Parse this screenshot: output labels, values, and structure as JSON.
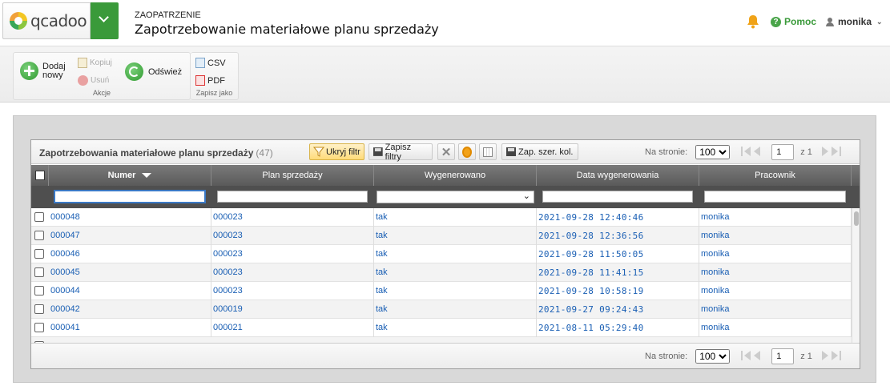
{
  "header": {
    "brand": "qcadoo",
    "breadcrumb": "ZAOPATRZENIE",
    "title": "Zapotrzebowanie materiałowe planu sprzedaży",
    "help": "Pomoc",
    "user": "monika"
  },
  "ribbon": {
    "actions": {
      "add": "Dodaj nowy",
      "add_l1": "Dodaj",
      "add_l2": "nowy",
      "copy": "Kopiuj",
      "delete": "Usuń",
      "refresh": "Odśwież",
      "group": "Akcje"
    },
    "export": {
      "csv": "CSV",
      "pdf": "PDF",
      "group": "Zapisz jako"
    }
  },
  "grid": {
    "title": "Zapotrzebowania materiałowe planu sprzedaży",
    "count": "(47)",
    "buttons": {
      "hide_filter": "Ukryj filtr",
      "save_filters": "Zapisz filtry",
      "save_widths": "Zap. szer. kol."
    },
    "paging": {
      "per_page_label": "Na stronie:",
      "per_page": "100",
      "page": "1",
      "of": "z 1"
    },
    "columns": [
      "Numer",
      "Plan sprzedaży",
      "Wygenerowano",
      "Data wygenerowania",
      "Pracownik"
    ],
    "rows": [
      {
        "numer": "000048",
        "plan": "000023",
        "gen": "tak",
        "date": "2021-09-28 12:40:46",
        "worker": "monika"
      },
      {
        "numer": "000047",
        "plan": "000023",
        "gen": "tak",
        "date": "2021-09-28 12:36:56",
        "worker": "monika"
      },
      {
        "numer": "000046",
        "plan": "000023",
        "gen": "tak",
        "date": "2021-09-28 11:50:05",
        "worker": "monika"
      },
      {
        "numer": "000045",
        "plan": "000023",
        "gen": "tak",
        "date": "2021-09-28 11:41:15",
        "worker": "monika"
      },
      {
        "numer": "000044",
        "plan": "000023",
        "gen": "tak",
        "date": "2021-09-28 10:58:19",
        "worker": "monika"
      },
      {
        "numer": "000042",
        "plan": "000019",
        "gen": "tak",
        "date": "2021-09-27 09:24:43",
        "worker": "monika"
      },
      {
        "numer": "000041",
        "plan": "000021",
        "gen": "tak",
        "date": "2021-08-11 05:29:40",
        "worker": "monika"
      }
    ]
  },
  "colors": {
    "accent_green": "#3a9a3a",
    "link_blue": "#1a5fb4",
    "header_dark": "#5a5a5a"
  }
}
